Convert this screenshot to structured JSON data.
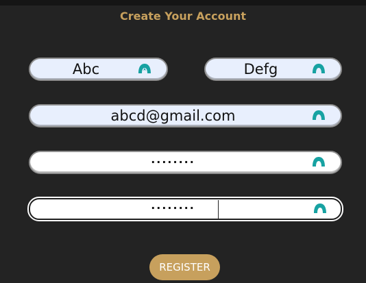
{
  "form": {
    "title": "Create Your Account",
    "first_name": {
      "value": "Abc"
    },
    "last_name": {
      "value": "Defg"
    },
    "email": {
      "value": "abcd@gmail.com"
    },
    "password": {
      "value": "········"
    },
    "confirm_password": {
      "value": "········"
    },
    "register_label": "REGISTER"
  },
  "colors": {
    "background": "#232323",
    "accent": "#c7a05d",
    "autofill": "#e8effd",
    "icon": "#17a2a2"
  },
  "icons": {
    "field_icon": "password-manager-icon"
  }
}
